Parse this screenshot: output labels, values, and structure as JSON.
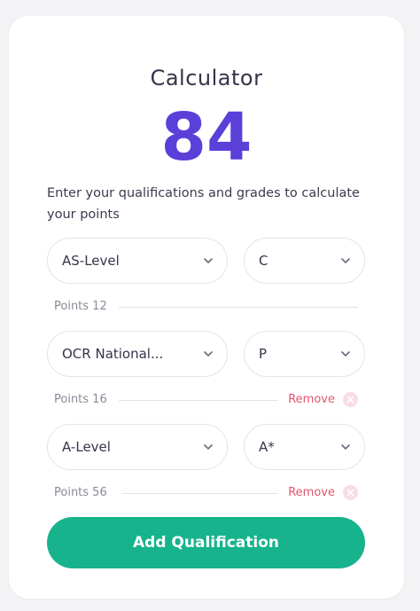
{
  "calculator": {
    "title": "Calculator",
    "score": "84",
    "description": "Enter your qualifications and grades to calculate your points"
  },
  "rows": [
    {
      "qualification": "AS-Level",
      "grade": "C",
      "points_label": "Points 12",
      "remove_label": ""
    },
    {
      "qualification": "OCR National...",
      "grade": "P",
      "points_label": "Points 16",
      "remove_label": "Remove"
    },
    {
      "qualification": "A-Level",
      "grade": "A*",
      "points_label": "Points 56",
      "remove_label": "Remove"
    }
  ],
  "add_button_label": "Add Qualification",
  "icons": {
    "dropdown": "chevron-down-icon",
    "remove": "close-circle-icon"
  },
  "colors": {
    "score": "#5b3fd9",
    "add_button": "#17b38d",
    "remove": "#e0566f",
    "remove_icon_bg": "#f9dde3"
  }
}
